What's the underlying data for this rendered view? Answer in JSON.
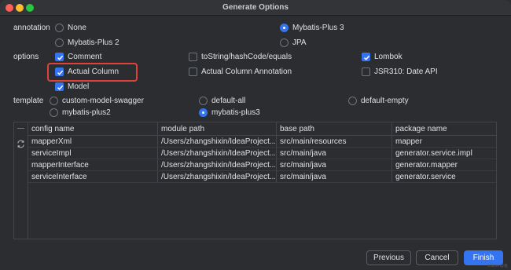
{
  "window": {
    "title": "Generate Options"
  },
  "annotation": {
    "label": "annotation",
    "options": [
      {
        "label": "None",
        "selected": false
      },
      {
        "label": "Mybatis-Plus 3",
        "selected": true
      },
      {
        "label": "Mybatis-Plus 2",
        "selected": false
      },
      {
        "label": "JPA",
        "selected": false
      }
    ]
  },
  "options": {
    "label": "options",
    "items": [
      {
        "label": "Comment",
        "checked": true
      },
      {
        "label": "toString/hashCode/equals",
        "checked": false
      },
      {
        "label": "Lombok",
        "checked": true
      },
      {
        "label": "Actual Column",
        "checked": true
      },
      {
        "label": "Actual Column Annotation",
        "checked": false
      },
      {
        "label": "JSR310: Date API",
        "checked": false
      },
      {
        "label": "Model",
        "checked": true
      }
    ]
  },
  "template": {
    "label": "template",
    "options": [
      {
        "label": "custom-model-swagger",
        "selected": false
      },
      {
        "label": "default-all",
        "selected": false
      },
      {
        "label": "default-empty",
        "selected": false
      },
      {
        "label": "mybatis-plus2",
        "selected": false
      },
      {
        "label": "mybatis-plus3",
        "selected": true
      }
    ]
  },
  "table": {
    "headers": [
      "config name",
      "module path",
      "base path",
      "package name"
    ],
    "rows": [
      [
        "mapperXml",
        "/Users/zhangshixin/IdeaProject...",
        "src/main/resources",
        "mapper"
      ],
      [
        "serviceImpl",
        "/Users/zhangshixin/IdeaProject...",
        "src/main/java",
        "generator.service.impl"
      ],
      [
        "mapperInterface",
        "/Users/zhangshixin/IdeaProject...",
        "src/main/java",
        "generator.mapper"
      ],
      [
        "serviceInterface",
        "/Users/zhangshixin/IdeaProject...",
        "src/main/java",
        "generator.service"
      ]
    ]
  },
  "buttons": {
    "previous": "Previous",
    "cancel": "Cancel",
    "finish": "Finish"
  },
  "watermark": "CSDN @鱼"
}
